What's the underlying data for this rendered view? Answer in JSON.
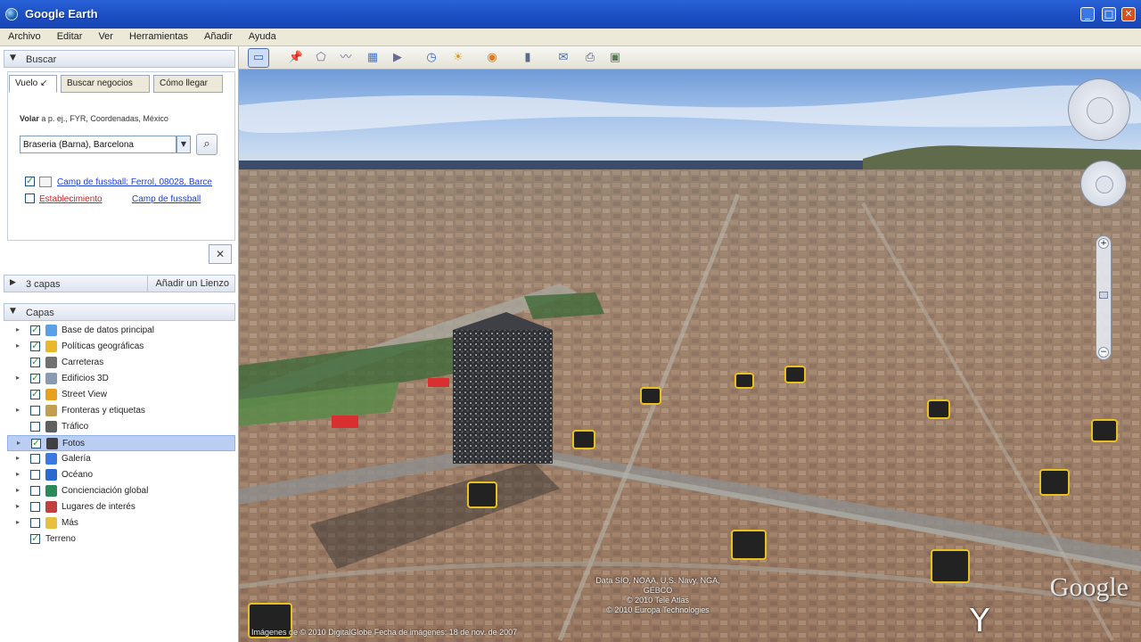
{
  "window": {
    "title": "Google Earth"
  },
  "menu": [
    "Archivo",
    "Editar",
    "Ver",
    "Herramientas",
    "Añadir",
    "Ayuda"
  ],
  "search_panel": {
    "header": "Buscar",
    "tabs": [
      "Vuelo ↙",
      "Buscar negocios",
      "Cómo llegar"
    ],
    "hint_label": "Volar",
    "hint_text": "a p. ej., FYR, Coordenadas, México",
    "input_value": "Braseria (Barna), Barcelona",
    "results": [
      {
        "text": "Camp de fussball: Ferrol, 08028, Barce",
        "color": "link"
      },
      {
        "text_red": "Establecimiento",
        "text_link": "Camp de fussball"
      }
    ]
  },
  "places_panel": {
    "header": "3 capas",
    "add_content": "Añadir un Lienzo"
  },
  "layers_panel": {
    "header": "Capas",
    "items": [
      {
        "label": "Base de datos principal",
        "checked": true,
        "expand": "▸",
        "icon": "globe-db-icon",
        "color": "#5aa0e8"
      },
      {
        "label": "Políticas geográficas",
        "checked": true,
        "expand": "▸",
        "icon": "star-icon",
        "color": "#e8b82a"
      },
      {
        "label": "Carreteras",
        "checked": true,
        "expand": "",
        "icon": "road-icon",
        "color": "#707070"
      },
      {
        "label": "Edificios 3D",
        "checked": true,
        "expand": "▸",
        "icon": "building-icon",
        "color": "#8a9ab0"
      },
      {
        "label": "Street View",
        "checked": true,
        "expand": "",
        "icon": "pegman-icon",
        "color": "#e8a020"
      },
      {
        "label": "Fronteras y etiquetas",
        "checked": false,
        "expand": "▸",
        "icon": "flag-icon",
        "color": "#c0a050"
      },
      {
        "label": "Tráfico",
        "checked": false,
        "expand": "",
        "icon": "traffic-icon",
        "color": "#606060"
      },
      {
        "label": "Fotos",
        "checked": true,
        "expand": "▸",
        "icon": "camera-icon",
        "color": "#404040",
        "selected": true
      },
      {
        "label": "Galería",
        "checked": false,
        "expand": "▸",
        "icon": "gallery-star-icon",
        "color": "#3a7ae0"
      },
      {
        "label": "Océano",
        "checked": false,
        "expand": "▸",
        "icon": "ocean-icon",
        "color": "#2a6ad0"
      },
      {
        "label": "Concienciación global",
        "checked": false,
        "expand": "▸",
        "icon": "earth-icon",
        "color": "#2a8a5a"
      },
      {
        "label": "Lugares de interés",
        "checked": false,
        "expand": "▸",
        "icon": "pin-icon",
        "color": "#c04040"
      },
      {
        "label": "Más",
        "checked": false,
        "expand": "▸",
        "icon": "folder-icon",
        "color": "#e8c040"
      },
      {
        "label": "Terreno",
        "checked": true,
        "expand": "",
        "icon": "",
        "color": ""
      }
    ]
  },
  "toolbar": {
    "buttons": [
      {
        "name": "hide-sidebar-button",
        "glyph": "▭",
        "color": "#3a62b0",
        "active": true
      },
      {
        "name": "add-placemark-button",
        "glyph": "📌",
        "color": "#d8a020"
      },
      {
        "name": "add-polygon-button",
        "glyph": "⬠",
        "color": "#6a6a9a"
      },
      {
        "name": "add-path-button",
        "glyph": "〰",
        "color": "#6a6a9a"
      },
      {
        "name": "add-image-overlay-button",
        "glyph": "▦",
        "color": "#3a7ae0"
      },
      {
        "name": "record-tour-button",
        "glyph": "▶",
        "color": "#6a6a9a"
      },
      {
        "name": "historical-imagery-button",
        "glyph": "◷",
        "color": "#3a62b0"
      },
      {
        "name": "sunlight-button",
        "glyph": "☀",
        "color": "#d8a020"
      },
      {
        "name": "planets-button",
        "glyph": "◉",
        "color": "#e07a20"
      },
      {
        "name": "ruler-button",
        "glyph": "▮",
        "color": "#5a6a8a"
      },
      {
        "name": "email-button",
        "glyph": "✉",
        "color": "#4a6aa0"
      },
      {
        "name": "print-button",
        "glyph": "⎙",
        "color": "#4a5a7a"
      },
      {
        "name": "view-in-maps-button",
        "glyph": "▣",
        "color": "#5a7a5a"
      }
    ]
  },
  "map": {
    "attribution_bottom": "Imágenes de © 2010 DigitalGlobe   Fecha de imágenes: 18 de nov. de 2007",
    "attribution_center": [
      "Data SIO, NOAA, U.S. Navy, NGA, GEBCO",
      "© 2010 Tele Atlas",
      "© 2010 Europa Technologies"
    ],
    "logo": "Google"
  }
}
